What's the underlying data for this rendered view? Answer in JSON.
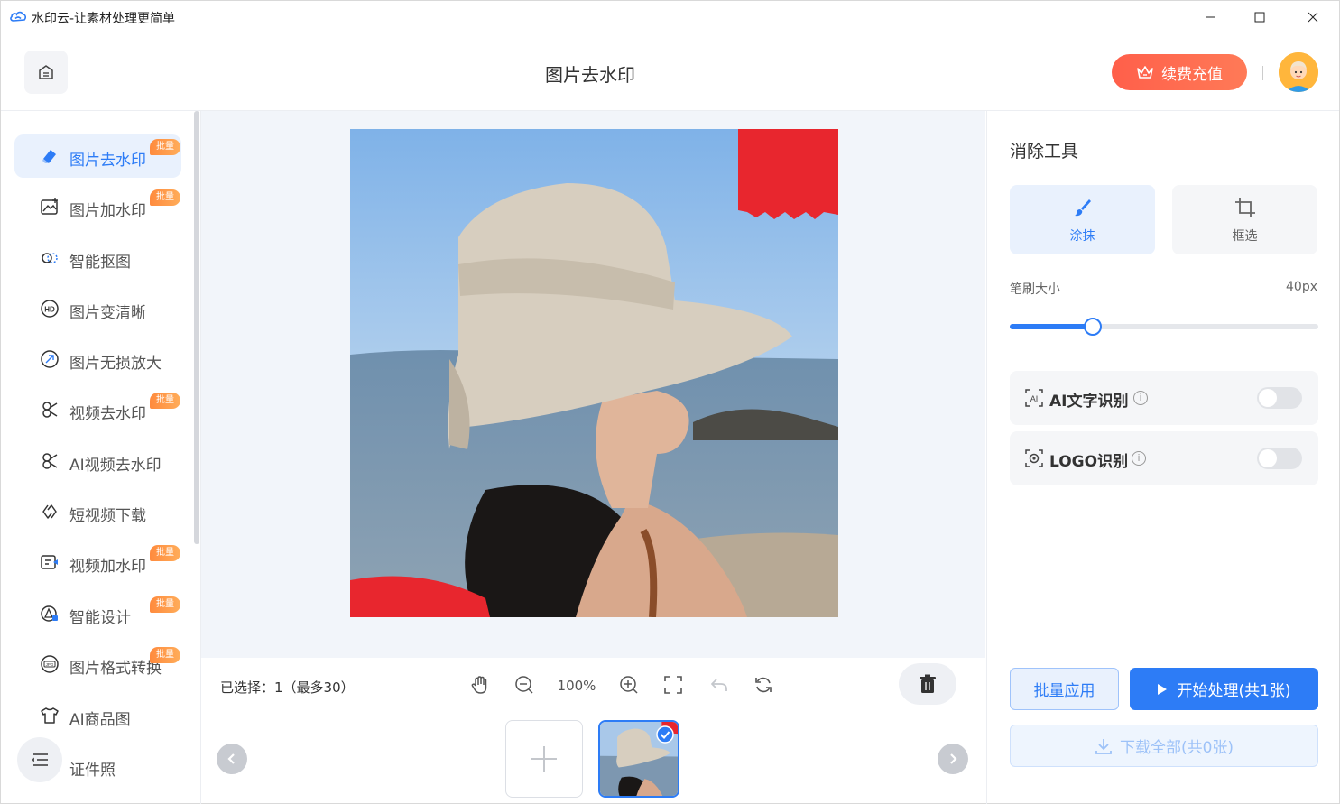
{
  "window": {
    "title": "水印云-让素材处理更简单",
    "minimize_icon": "minimize-icon",
    "maximize_icon": "maximize-icon",
    "close_icon": "close-icon"
  },
  "header": {
    "page_title": "图片去水印",
    "recharge_label": "续费充值",
    "home_icon": "home-icon",
    "crown_icon": "crown-icon"
  },
  "sidebar": {
    "items": [
      {
        "label": "图片去水印",
        "badge": "批量",
        "icon": "eraser-icon",
        "active": true
      },
      {
        "label": "图片加水印",
        "badge": "批量",
        "icon": "image-add-icon"
      },
      {
        "label": "智能抠图",
        "badge": "",
        "icon": "cutout-icon"
      },
      {
        "label": "图片变清晰",
        "badge": "",
        "icon": "hd-icon"
      },
      {
        "label": "图片无损放大",
        "badge": "",
        "icon": "enlarge-icon"
      },
      {
        "label": "视频去水印",
        "badge": "批量",
        "icon": "video-eraser-icon"
      },
      {
        "label": "AI视频去水印",
        "badge": "",
        "icon": "ai-video-eraser-icon"
      },
      {
        "label": "短视频下载",
        "badge": "",
        "icon": "link-icon"
      },
      {
        "label": "视频加水印",
        "badge": "批量",
        "icon": "video-add-icon"
      },
      {
        "label": "智能设计",
        "badge": "批量",
        "icon": "design-icon"
      },
      {
        "label": "图片格式转换",
        "badge": "批量",
        "icon": "jpg-convert-icon"
      },
      {
        "label": "AI商品图",
        "badge": "",
        "icon": "shirt-icon"
      },
      {
        "label": "证件照",
        "badge": "",
        "icon": "id-photo-icon"
      }
    ]
  },
  "canvas": {
    "selected_text": "已选择：1（最多30）",
    "zoom": "100%"
  },
  "right_panel": {
    "title": "消除工具",
    "modes": [
      {
        "label": "涂抹",
        "icon": "brush-icon",
        "active": true
      },
      {
        "label": "框选",
        "icon": "crop-icon",
        "active": false
      }
    ],
    "brush_label": "笔刷大小",
    "brush_value": "40px",
    "brush_level_percent": 27,
    "features": [
      {
        "label": "AI文字识别",
        "icon": "ai-text-icon",
        "enabled": false
      },
      {
        "label": "LOGO识别",
        "icon": "logo-detect-icon",
        "enabled": false
      }
    ],
    "info_glyph": "i",
    "batch_apply": "批量应用",
    "start_process": "开始处理(共1张)",
    "download_all": "下载全部(共0张)"
  },
  "colors": {
    "accent": "#2d7cf6",
    "recharge": "#ff6a4f",
    "badge": "#ff9a48"
  }
}
